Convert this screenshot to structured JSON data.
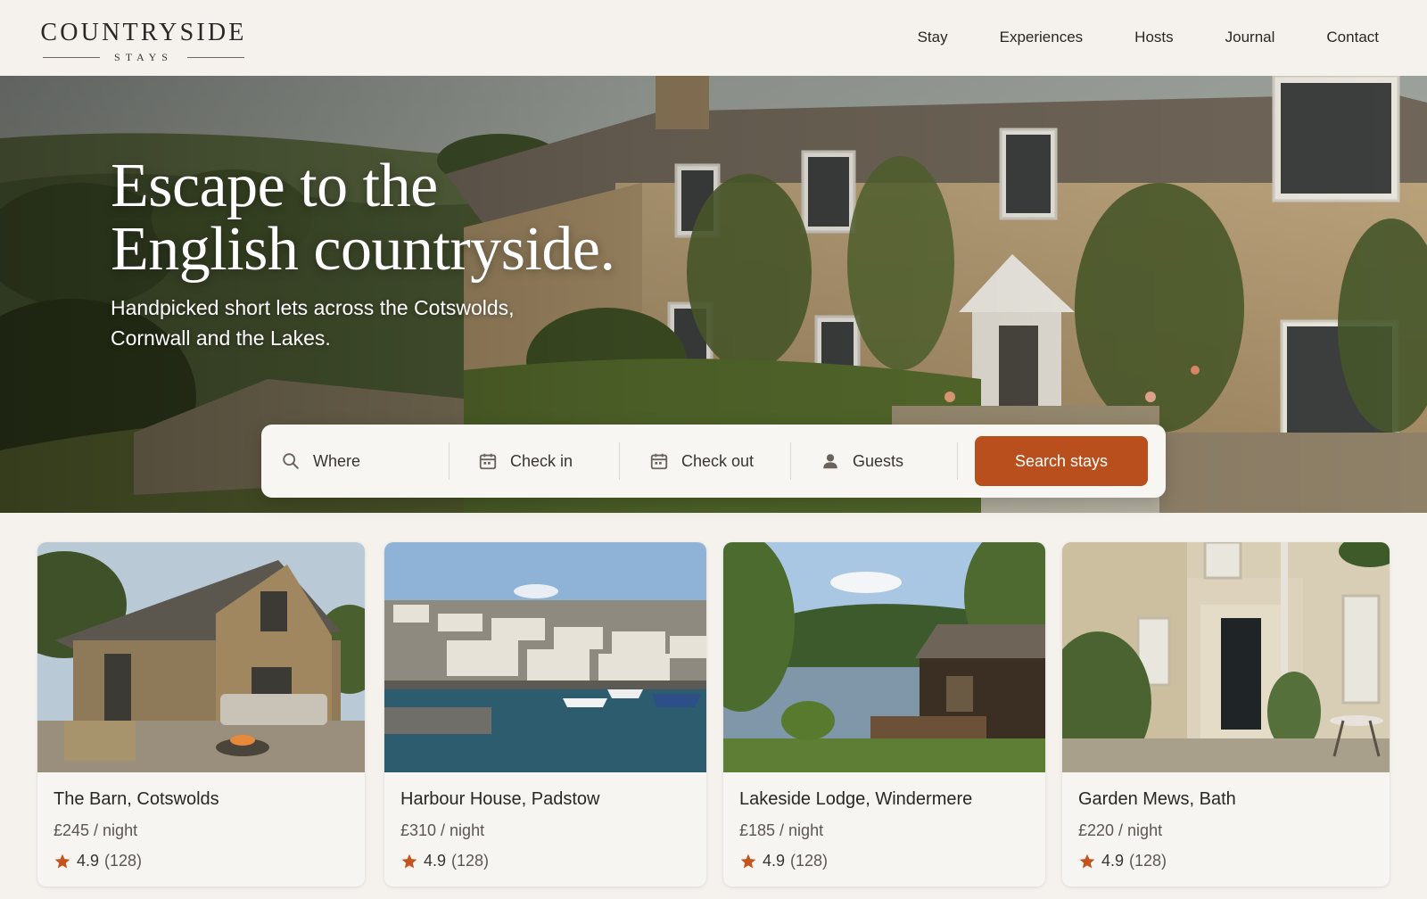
{
  "brand": {
    "name": "COUNTRYSIDE",
    "tagline": "STAYS"
  },
  "nav": {
    "items": [
      "Stay",
      "Experiences",
      "Hosts",
      "Journal",
      "Contact"
    ]
  },
  "hero": {
    "title_line1": "Escape to the",
    "title_line2": "English countryside.",
    "subtitle_line1": "Handpicked short lets across the Cotswolds,",
    "subtitle_line2": "Cornwall and the Lakes."
  },
  "search": {
    "where": "Where",
    "check_in": "Check in",
    "check_out": "Check out",
    "guests": "Guests",
    "button": "Search stays",
    "icons": [
      "search-icon",
      "calendar-icon",
      "calendar-icon",
      "person-icon"
    ]
  },
  "listings": [
    {
      "name": "The Barn, Cotswolds",
      "price": "£245 / night",
      "rating": "4.9",
      "reviews": "(128)"
    },
    {
      "name": "Harbour House, Padstow",
      "price": "£310 / night",
      "rating": "4.9",
      "reviews": "(128)"
    },
    {
      "name": "Lakeside Lodge, Windermere",
      "price": "£185 / night",
      "rating": "4.9",
      "reviews": "(128)"
    },
    {
      "name": "Garden Mews, Bath",
      "price": "£220 / night",
      "rating": "4.9",
      "reviews": "(128)"
    }
  ],
  "colors": {
    "accent": "#b94f1c",
    "background": "#f5f2ee",
    "star": "#c4541d",
    "text": "#2a2622"
  }
}
